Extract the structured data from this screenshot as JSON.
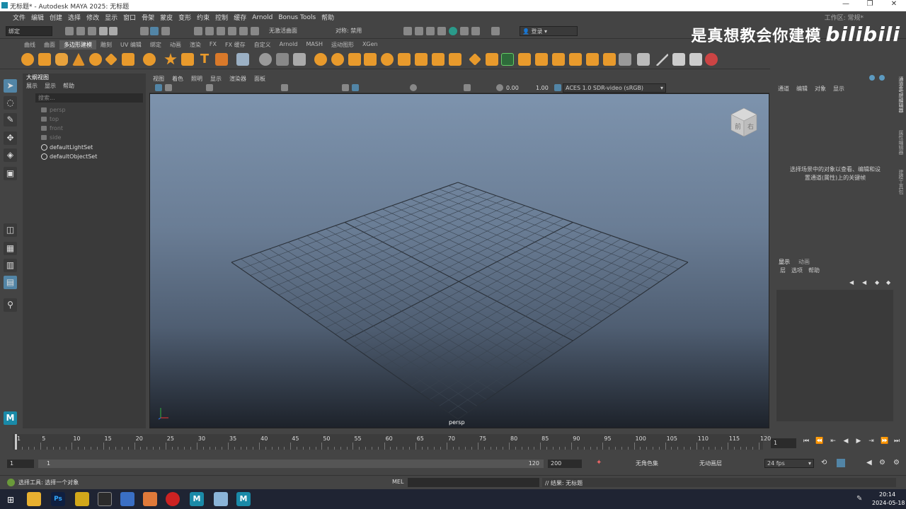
{
  "titlebar": {
    "title": "无标题* - Autodesk MAYA 2025: 无标题",
    "controls": [
      "—",
      "❐",
      "✕"
    ]
  },
  "menubar": {
    "items": [
      "文件",
      "编辑",
      "创建",
      "选择",
      "修改",
      "显示",
      "窗口",
      "骨架",
      "蒙皮",
      "变形",
      "约束",
      "控制",
      "缓存",
      "Arnold",
      "Bonus Tools",
      "帮助"
    ],
    "workspace_label": "工作区:",
    "workspace_value": "常规*"
  },
  "statusline": {
    "menuset": "绑定",
    "live_surface": "无激活曲面",
    "symmetry": "对称: 禁用",
    "login": "登录"
  },
  "watermark": {
    "text": "是真想教会你建模",
    "brand": "bilibili"
  },
  "shelf_tabs": {
    "items": [
      "曲线",
      "曲面",
      "多边形建模",
      "雕刻",
      "UV 编辑",
      "绑定",
      "动画",
      "渲染",
      "FX",
      "FX 缓存",
      "自定义",
      "Arnold",
      "MASH",
      "运动图形",
      "XGen"
    ],
    "active_index": 2
  },
  "outliner": {
    "title": "大纲视图",
    "menus": [
      "展示",
      "显示",
      "帮助"
    ],
    "search_placeholder": "搜索...",
    "cameras": [
      "persp",
      "top",
      "front",
      "side"
    ],
    "sets": [
      "defaultLightSet",
      "defaultObjectSet"
    ]
  },
  "viewport": {
    "menus": [
      "视图",
      "着色",
      "照明",
      "显示",
      "渲染器",
      "面板"
    ],
    "exposure": "0.00",
    "gamma": "1.00",
    "colorspace": "ACES 1.0 SDR-video (sRGB)",
    "camera_label": "persp",
    "viewcube_front": "前",
    "viewcube_right": "右"
  },
  "channelbox": {
    "menus": [
      "通道",
      "编辑",
      "对象",
      "显示"
    ],
    "hint_line1": "选择场景中的对象以查看、编辑和设",
    "hint_line2": "置通道(属性)上的关键帧"
  },
  "layers": {
    "tabs": [
      "显示",
      "动画"
    ],
    "menus": [
      "层",
      "选项",
      "帮助"
    ]
  },
  "side_tabs": [
    "通道盒/层编辑器",
    "属性编辑器",
    "建模工具包"
  ],
  "timeline": {
    "ticks": [
      1,
      5,
      10,
      15,
      20,
      25,
      30,
      35,
      40,
      45,
      50,
      55,
      60,
      65,
      70,
      75,
      80,
      85,
      90,
      95,
      100,
      105,
      110,
      115,
      120
    ],
    "current_frame": "1"
  },
  "range": {
    "start": "1",
    "inner_start": "1",
    "inner_end": "120",
    "end": "200",
    "character_set": "无角色集",
    "anim_layer": "无动画层",
    "fps": "24 fps"
  },
  "cmdline": {
    "help_text": "选择工具: 选择一个对象",
    "lang": "MEL",
    "result": "// 结果: 无标题"
  },
  "taskbar": {
    "time": "20:14",
    "date": "2024-05-18"
  },
  "colors": {
    "accent": "#5285a6",
    "active_tool": "#5285a6",
    "maya_teal": "#1a8aa8"
  }
}
